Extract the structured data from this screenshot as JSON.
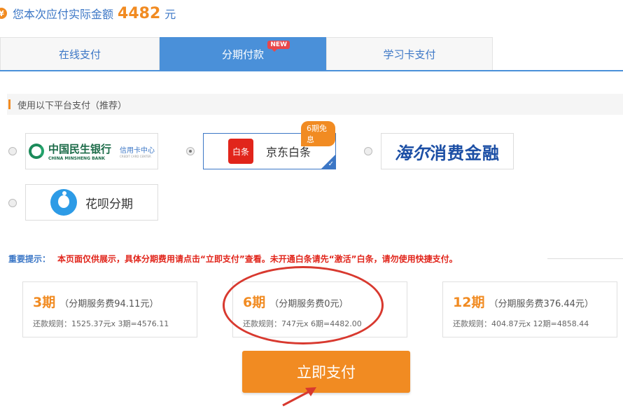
{
  "header": {
    "currency_icon": "¥",
    "label": "您本次应付实际金额",
    "amount": "4482",
    "unit": "元"
  },
  "tabs": [
    {
      "label": "在线支付",
      "active": false
    },
    {
      "label": "分期付款",
      "active": true,
      "badge": "NEW"
    },
    {
      "label": "学习卡支付",
      "active": false
    }
  ],
  "section": {
    "title": "使用以下平台支付（推荐）"
  },
  "payment_options": {
    "cmbc": {
      "name": "中国民生银行",
      "en": "CHINA MINSHENG BANK",
      "sub": "信用卡中心",
      "sub_en": "CREDIT CARD CENTER",
      "selected": false
    },
    "jd": {
      "icon_text": "白条",
      "name": "京东白条",
      "badge": "6期免息",
      "selected": true
    },
    "haier": {
      "name_script": "海尔",
      "name": "消费金融",
      "selected": false
    },
    "huabei": {
      "name": "花呗分期",
      "selected": false
    }
  },
  "notice": {
    "title": "重要提示：",
    "body": "本页面仅供展示，具体分期费用请点击“立即支付”查看。未开通白条请先“激活”白条，请勿使用快捷支付。"
  },
  "plans": [
    {
      "period": "3期",
      "fee": "（分期服务费94.11元）",
      "rule": "还款规则：1525.37元x 3期=4576.11"
    },
    {
      "period": "6期",
      "fee": "（分期服务费0元）",
      "rule": "还款规则：747元x 6期=4482.00"
    },
    {
      "period": "12期",
      "fee": "（分期服务费376.44元）",
      "rule": "还款规则：404.87元x 12期=4858.44"
    }
  ],
  "pay_button": {
    "label": "立即支付"
  },
  "colors": {
    "accent_orange": "#f18b22",
    "tab_blue": "#4a90d9",
    "annotation_red": "#d8392f"
  }
}
